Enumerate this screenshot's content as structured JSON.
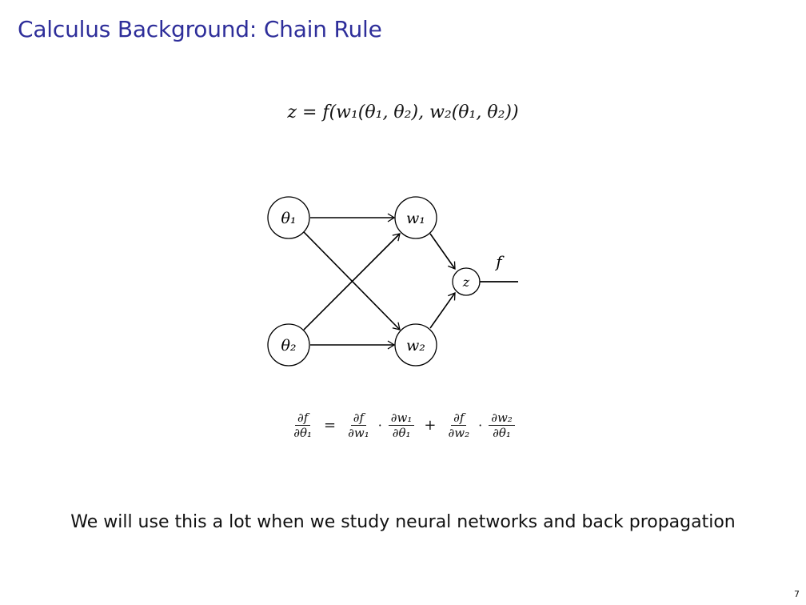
{
  "title": "Calculus Background: Chain Rule",
  "equation_top": {
    "lhs": "z",
    "eq": "=",
    "rhs": "f(w₁(θ₁, θ₂), w₂(θ₁, θ₂))"
  },
  "diagram": {
    "nodes": {
      "theta1": "θ₁",
      "theta2": "θ₂",
      "w1": "w₁",
      "w2": "w₂",
      "z": "z"
    },
    "output_label": "f"
  },
  "chain_rule": {
    "lhs_num": "∂f",
    "lhs_den": "∂θ₁",
    "eq": "=",
    "t1_num": "∂f",
    "t1_den": "∂w₁",
    "t2_num": "∂w₁",
    "t2_den": "∂θ₁",
    "plus": "+",
    "t3_num": "∂f",
    "t3_den": "∂w₂",
    "t4_num": "∂w₂",
    "t4_den": "∂θ₁",
    "dot": "·"
  },
  "caption": "We will use this a lot when we study neural networks and back propagation",
  "page_number": "7"
}
